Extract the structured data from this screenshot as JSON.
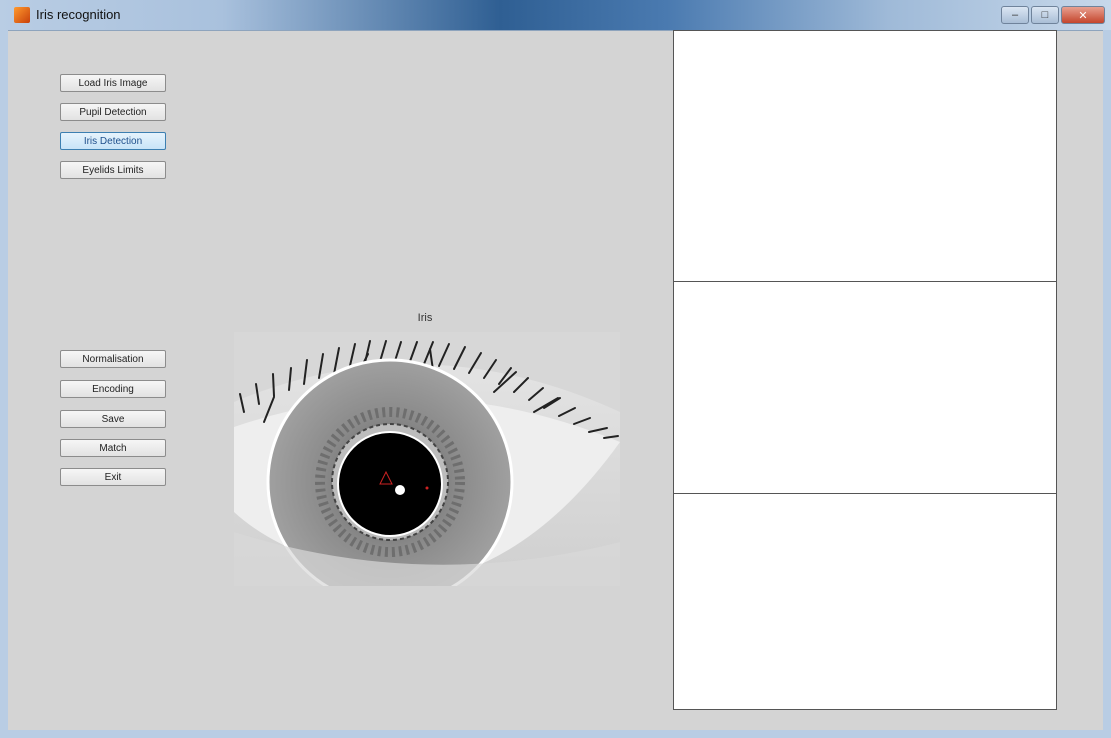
{
  "window": {
    "title": "Iris recognition"
  },
  "top_buttons": [
    {
      "label": "Load Iris Image"
    },
    {
      "label": "Pupil Detection"
    },
    {
      "label": "Iris Detection"
    },
    {
      "label": "Eyelids Limits"
    }
  ],
  "bottom_buttons": [
    {
      "label": "Normalisation"
    },
    {
      "label": "Encoding"
    },
    {
      "label": "Save"
    },
    {
      "label": "Match"
    },
    {
      "label": "Exit"
    }
  ],
  "axes": {
    "title": "Iris"
  },
  "colors": {
    "background": "#d4d4d4",
    "active_button_border": "#3c7fb1",
    "iris_circle": "#ffffff",
    "pupil": "#000000",
    "marker": "#cc2222"
  },
  "icons": {
    "app": "matlab-icon",
    "minimize": "minimize-icon",
    "maximize": "maximize-icon",
    "close": "close-icon"
  }
}
